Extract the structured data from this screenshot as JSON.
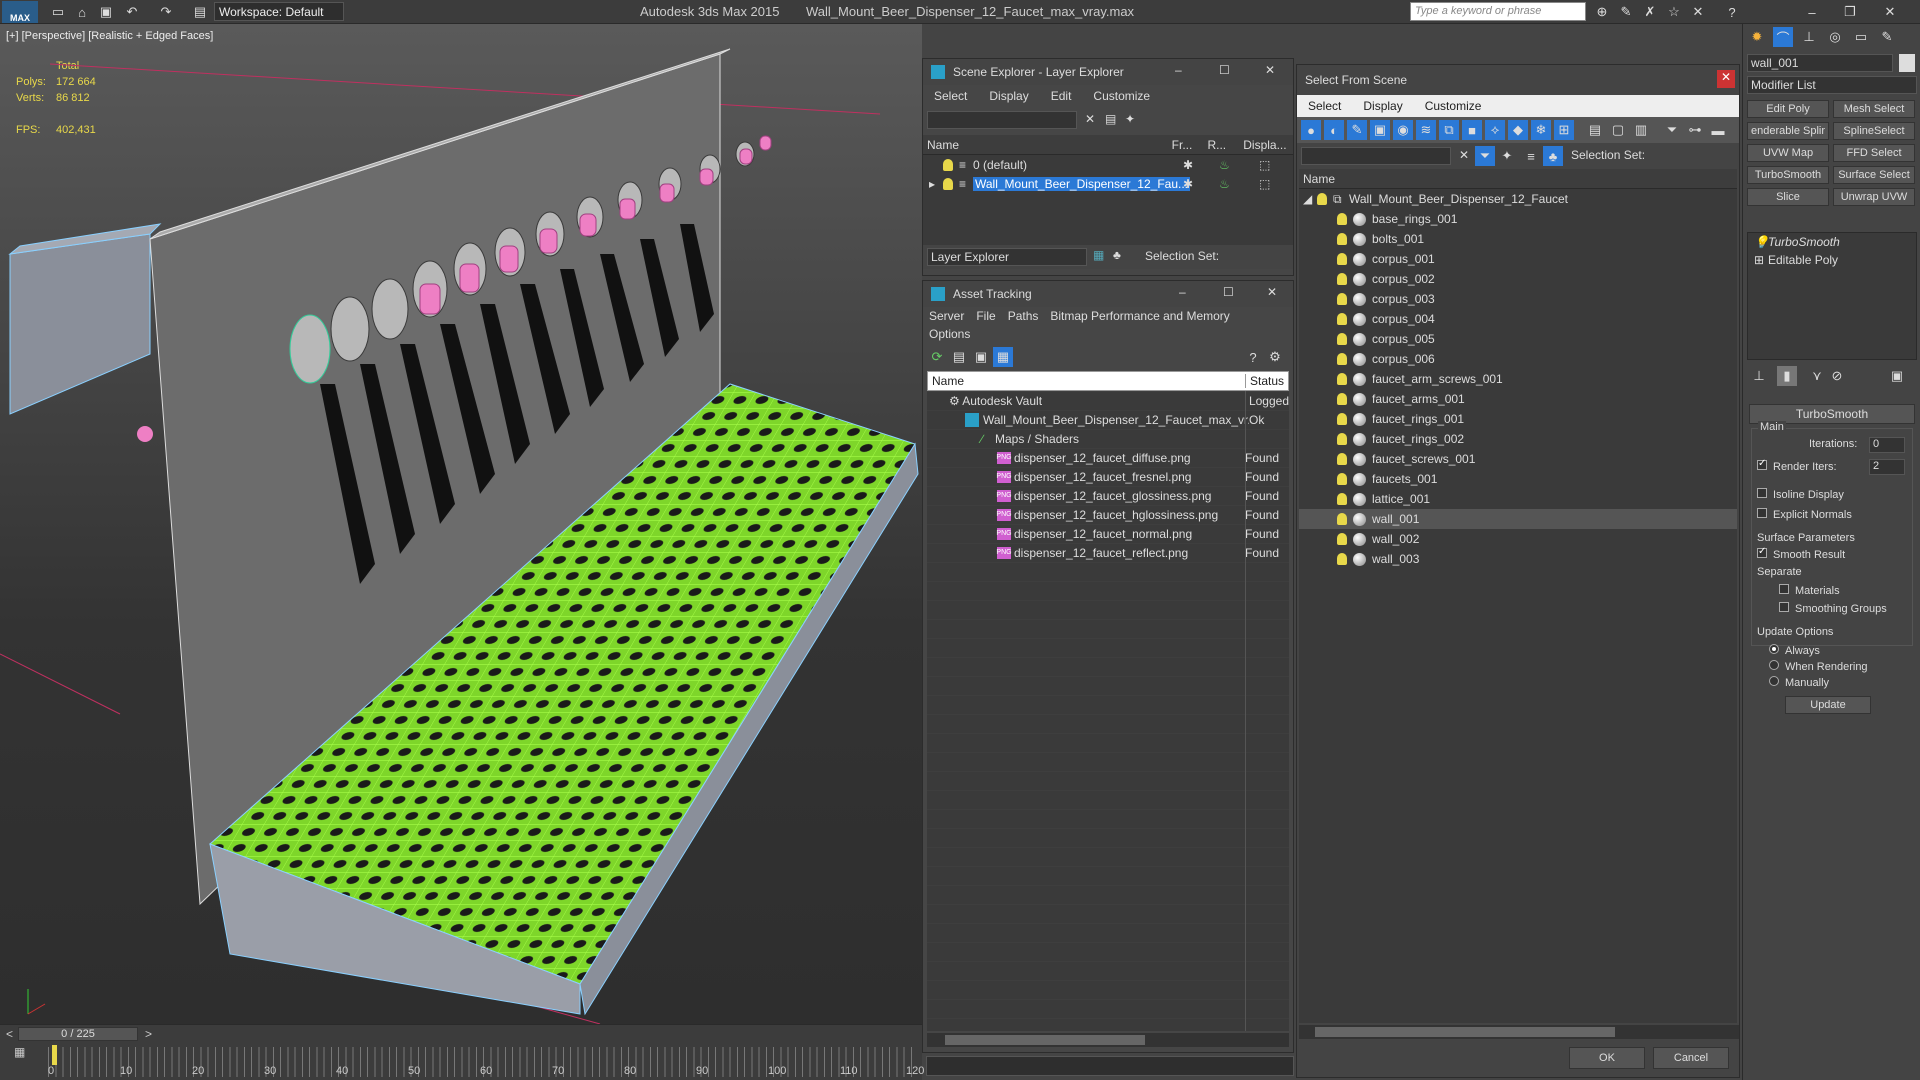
{
  "titlebar": {
    "app_logo": "MAX",
    "workspace": "Workspace: Default",
    "title": "Autodesk 3ds Max  2015",
    "filename": "Wall_Mount_Beer_Dispenser_12_Faucet_max_vray.max",
    "search_placeholder": "Type a keyword or phrase"
  },
  "viewport": {
    "label": "[+] [Perspective] [Realistic + Edged Faces]",
    "stats": {
      "total_label": "Total",
      "polys_label": "Polys:",
      "polys_value": "172 664",
      "verts_label": "Verts:",
      "verts_value": "86 812",
      "fps_label": "FPS:",
      "fps_value": "402,431"
    }
  },
  "timeline": {
    "frame": "0 / 225",
    "ticks": [
      "0",
      "10",
      "20",
      "30",
      "40",
      "50",
      "60",
      "70",
      "80",
      "90",
      "100",
      "110",
      "120"
    ]
  },
  "scene_explorer": {
    "title": "Scene Explorer - Layer Explorer",
    "menu": [
      "Select",
      "Display",
      "Edit",
      "Customize"
    ],
    "columns": [
      "Name",
      "Fr...",
      "R...",
      "Displa..."
    ],
    "rows": [
      {
        "name": "0 (default)",
        "selected": false
      },
      {
        "name": "Wall_Mount_Beer_Dispenser_12_Fau...",
        "selected": true
      }
    ],
    "footer_dropdown": "Layer Explorer",
    "selection_set_label": "Selection Set:"
  },
  "asset_tracking": {
    "title": "Asset Tracking",
    "menu": [
      "Server",
      "File",
      "Paths",
      "Bitmap Performance and Memory"
    ],
    "menu2": [
      "Options"
    ],
    "columns": [
      "Name",
      "Status"
    ],
    "rows": [
      {
        "name": "Autodesk Vault",
        "status": "Logged",
        "indent": 1,
        "kind": "vault"
      },
      {
        "name": "Wall_Mount_Beer_Dispenser_12_Faucet_max_vr...",
        "status": "Ok",
        "indent": 2,
        "kind": "file"
      },
      {
        "name": "Maps / Shaders",
        "status": "",
        "indent": 3,
        "kind": "folder"
      },
      {
        "name": "dispenser_12_faucet_diffuse.png",
        "status": "Found",
        "indent": 4,
        "kind": "png"
      },
      {
        "name": "dispenser_12_faucet_fresnel.png",
        "status": "Found",
        "indent": 4,
        "kind": "png"
      },
      {
        "name": "dispenser_12_faucet_glossiness.png",
        "status": "Found",
        "indent": 4,
        "kind": "png"
      },
      {
        "name": "dispenser_12_faucet_hglossiness.png",
        "status": "Found",
        "indent": 4,
        "kind": "png"
      },
      {
        "name": "dispenser_12_faucet_normal.png",
        "status": "Found",
        "indent": 4,
        "kind": "png"
      },
      {
        "name": "dispenser_12_faucet_reflect.png",
        "status": "Found",
        "indent": 4,
        "kind": "png"
      }
    ]
  },
  "select_from_scene": {
    "title": "Select From Scene",
    "menu": [
      "Select",
      "Display",
      "Customize"
    ],
    "selection_set_label": "Selection Set:",
    "column": "Name",
    "root": "Wall_Mount_Beer_Dispenser_12_Faucet",
    "items": [
      "base_rings_001",
      "bolts_001",
      "corpus_001",
      "corpus_002",
      "corpus_003",
      "corpus_004",
      "corpus_005",
      "corpus_006",
      "faucet_arm_screws_001",
      "faucet_arms_001",
      "faucet_rings_001",
      "faucet_rings_002",
      "faucet_screws_001",
      "faucets_001",
      "lattice_001",
      "wall_001",
      "wall_002",
      "wall_003"
    ],
    "selected_item": "wall_001",
    "ok": "OK",
    "cancel": "Cancel"
  },
  "command_panel": {
    "object_name": "wall_001",
    "modifier_list": "Modifier List",
    "buttons": [
      "Edit Poly",
      "Mesh Select",
      "enderable Splir",
      "SplineSelect",
      "UVW Map",
      "FFD Select",
      "TurboSmooth",
      "Surface Select",
      "Slice",
      "Unwrap UVW"
    ],
    "stack": [
      "TurboSmooth",
      "Editable Poly"
    ],
    "rollout_title": "TurboSmooth",
    "main_label": "Main",
    "iterations_label": "Iterations:",
    "iterations_value": "0",
    "render_iters_label": "Render Iters:",
    "render_iters_value": "2",
    "isoline_label": "Isoline Display",
    "explicit_label": "Explicit Normals",
    "surface_params_label": "Surface Parameters",
    "smooth_result_label": "Smooth Result",
    "separate_label": "Separate",
    "materials_label": "Materials",
    "smoothing_groups_label": "Smoothing Groups",
    "update_options_label": "Update Options",
    "always_label": "Always",
    "when_rendering_label": "When Rendering",
    "manually_label": "Manually",
    "update_button": "Update"
  }
}
